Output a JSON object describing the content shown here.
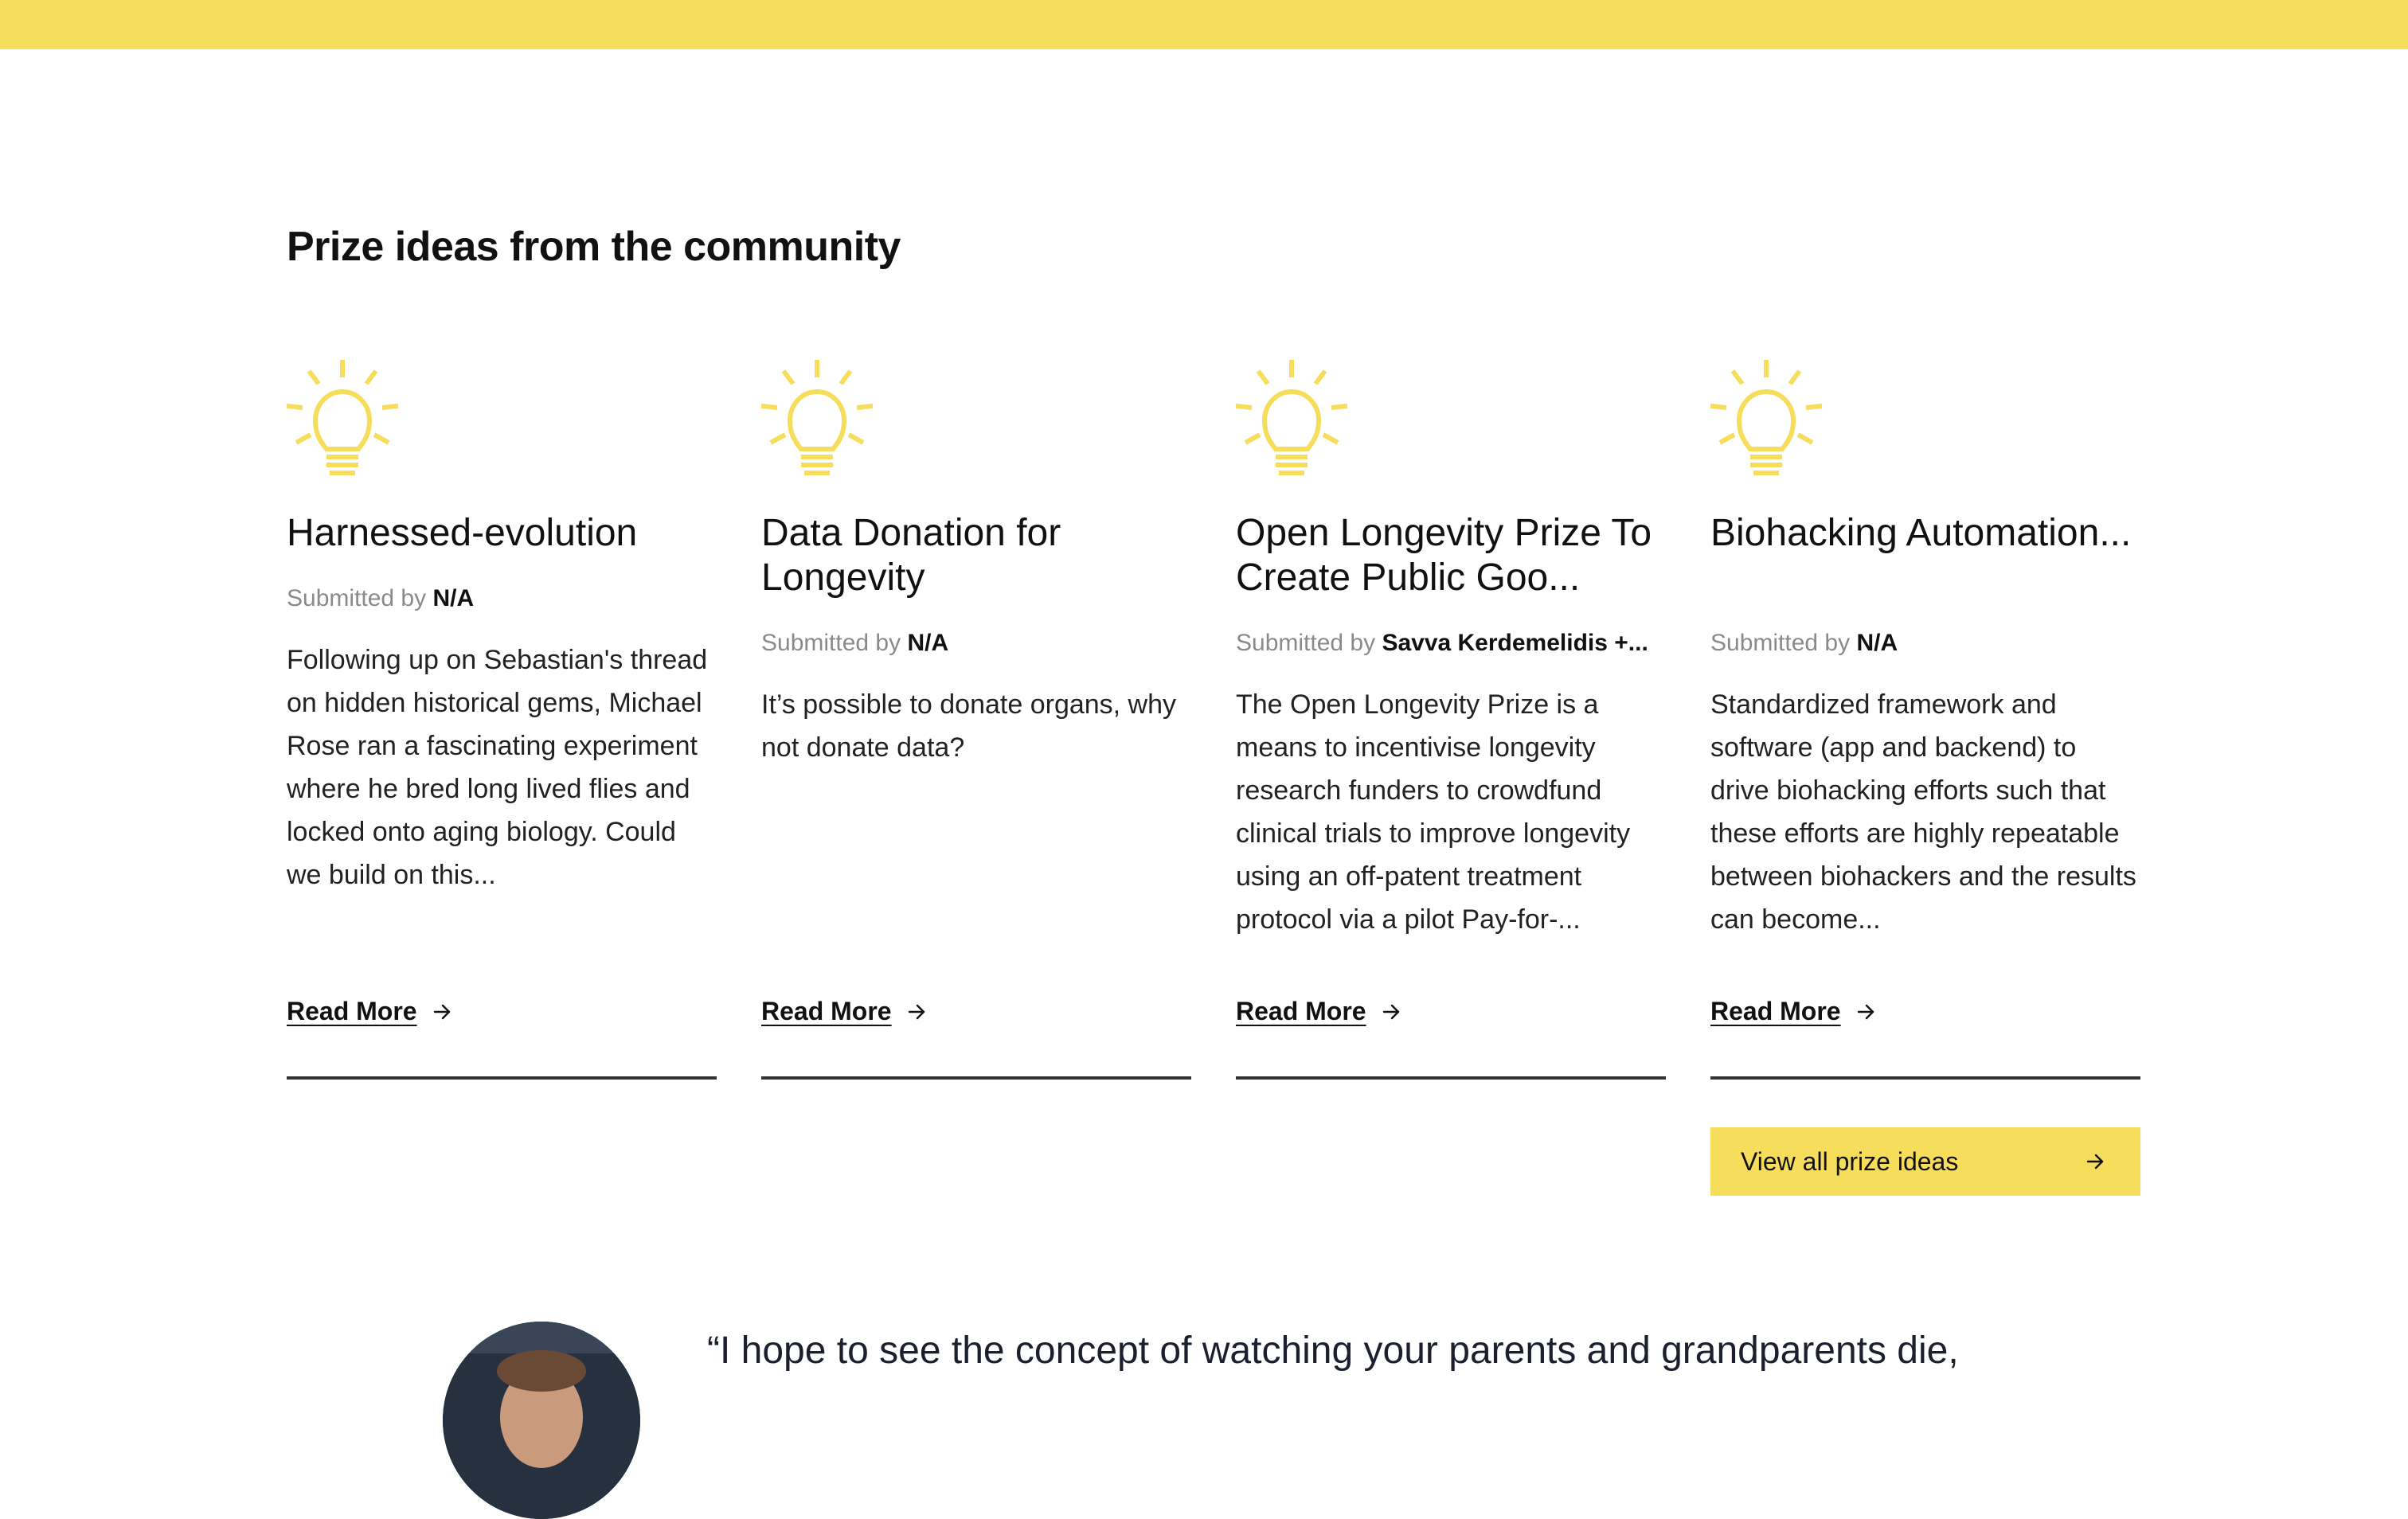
{
  "section": {
    "title": "Prize ideas from the community"
  },
  "icons": {
    "card_icon": "lightbulb-icon",
    "arrow": "arrow-right-icon",
    "color": "#f7dd5c"
  },
  "cards": [
    {
      "title": "Harnessed-evolution",
      "submitted_prefix": "Submitted by",
      "submitted_by": "N/A",
      "description": "Following up on Sebastian's thread on hidden historical gems, Michael Rose ran a fascinating experiment where he bred long lived flies and locked onto aging biology. Could we build on this...",
      "read_more": "Read More"
    },
    {
      "title": "Data Donation for Longevity",
      "submitted_prefix": "Submitted by",
      "submitted_by": "N/A",
      "description": "It’s possible to donate organs, why not donate data?",
      "read_more": "Read More"
    },
    {
      "title": "Open Longevity Prize To Create Public Goo...",
      "submitted_prefix": "Submitted by",
      "submitted_by": "Savva Kerdemelidis +...",
      "description": "The Open Longevity Prize is a means to incentivise longevity research funders to crowdfund clinical trials to improve longevity using an off-patent treatment protocol via a pilot Pay-for-...",
      "read_more": "Read More"
    },
    {
      "title": "Biohacking Automation...",
      "submitted_prefix": "Submitted by",
      "submitted_by": "N/A",
      "description": "Standardized framework and software (app and backend) to drive biohacking efforts such that these efforts are highly repeatable between biohackers and the results can become...",
      "read_more": "Read More"
    }
  ],
  "view_all": {
    "label": "View all prize ideas"
  },
  "testimonial": {
    "quote": "“I hope to see the concept of watching your parents and grandparents die,"
  },
  "colors": {
    "accent": "#f7dd5c",
    "text": "#111111",
    "muted": "#8a8a8a"
  }
}
